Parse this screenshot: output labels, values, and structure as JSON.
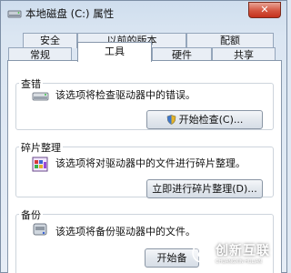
{
  "window": {
    "title": "本地磁盘 (C:) 属性",
    "close_symbol": "✕"
  },
  "tabs_row1": [
    "安全",
    "以前的版本",
    "配额"
  ],
  "tabs_row2": [
    "常规",
    "工具",
    "硬件",
    "共享"
  ],
  "active_tab": "工具",
  "sections": {
    "check": {
      "label": "查错",
      "description": "该选项将检查驱动器中的错误。",
      "button": "开始检查(C)...",
      "icon": "drive-check-icon"
    },
    "defrag": {
      "label": "碎片整理",
      "description": "该选项将对驱动器中的文件进行碎片整理。",
      "button": "立即进行碎片整理(D)...",
      "icon": "defrag-icon"
    },
    "backup": {
      "label": "备份",
      "description": "该选项将备份驱动器中的文件。",
      "button": "开始备",
      "icon": "backup-icon"
    }
  },
  "watermark": {
    "text": "创新互联",
    "subtext": "CHUANGXIN HULIAN"
  },
  "colors": {
    "title_bg": "#cfdeee",
    "close_button": "#d4553f",
    "panel_bg": "#ffffff"
  }
}
